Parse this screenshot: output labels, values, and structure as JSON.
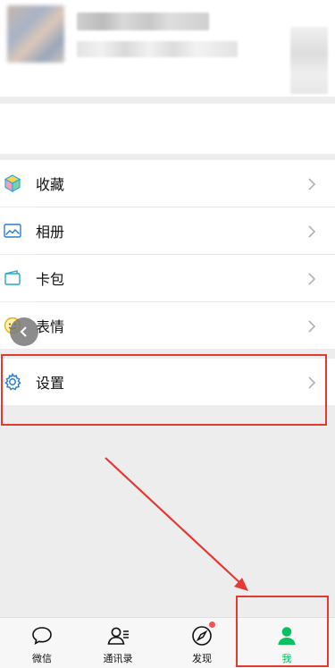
{
  "menu": {
    "items": [
      {
        "id": "favorites",
        "label": "收藏",
        "icon": "cube-icon"
      },
      {
        "id": "album",
        "label": "相册",
        "icon": "image-icon"
      },
      {
        "id": "card",
        "label": "卡包",
        "icon": "card-wallet-icon"
      },
      {
        "id": "emoji",
        "label": "表情",
        "icon": "smiley-icon"
      },
      {
        "id": "settings",
        "label": "设置",
        "icon": "gear-icon"
      }
    ]
  },
  "tabbar": {
    "tabs": [
      {
        "label": "微信",
        "icon": "chat-bubble-icon"
      },
      {
        "label": "通讯录",
        "icon": "contacts-icon"
      },
      {
        "label": "发现",
        "icon": "compass-icon"
      },
      {
        "label": "我",
        "icon": "person-icon"
      }
    ],
    "active_index": 3
  },
  "colors": {
    "accent_green": "#07c160",
    "annotation_red": "#e53935",
    "badge_red": "#fa5151"
  }
}
